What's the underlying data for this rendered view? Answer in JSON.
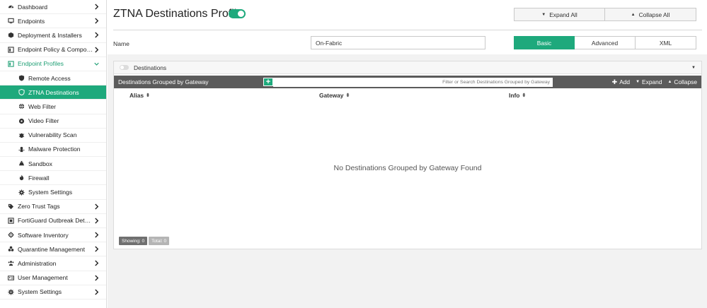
{
  "sidebar": {
    "items": [
      {
        "label": "Dashboard",
        "icon": "dashboard-icon"
      },
      {
        "label": "Endpoints",
        "icon": "monitor-icon"
      },
      {
        "label": "Deployment & Installers",
        "icon": "box-icon"
      },
      {
        "label": "Endpoint Policy & Components",
        "icon": "policy-icon"
      },
      {
        "label": "Endpoint Profiles",
        "icon": "profile-icon"
      },
      {
        "label": "Remote Access",
        "icon": "shield-icon"
      },
      {
        "label": "ZTNA Destinations",
        "icon": "shield-icon"
      },
      {
        "label": "Web Filter",
        "icon": "globe-icon"
      },
      {
        "label": "Video Filter",
        "icon": "video-icon"
      },
      {
        "label": "Vulnerability Scan",
        "icon": "bug-icon"
      },
      {
        "label": "Malware Protection",
        "icon": "malware-icon"
      },
      {
        "label": "Sandbox",
        "icon": "sandbox-icon"
      },
      {
        "label": "Firewall",
        "icon": "fire-icon"
      },
      {
        "label": "System Settings",
        "icon": "gear-icon"
      },
      {
        "label": "Zero Trust Tags",
        "icon": "tag-icon"
      },
      {
        "label": "FortiGuard Outbreak Detecti...",
        "icon": "outbreak-icon"
      },
      {
        "label": "Software Inventory",
        "icon": "inventory-icon"
      },
      {
        "label": "Quarantine Management",
        "icon": "biohazard-icon"
      },
      {
        "label": "Administration",
        "icon": "users-icon"
      },
      {
        "label": "User Management",
        "icon": "user-card-icon"
      },
      {
        "label": "System Settings",
        "icon": "gear-icon"
      }
    ]
  },
  "header": {
    "title": "ZTNA Destinations Profile",
    "expand_all": "Expand All",
    "collapse_all": "Collapse All"
  },
  "form": {
    "name_label": "Name",
    "name_value": "On-Fabric",
    "tabs": [
      "Basic",
      "Advanced",
      "XML"
    ],
    "active_tab": "Basic"
  },
  "destinations": {
    "section_title": "Destinations",
    "grid_title": "Destinations Grouped by Gateway",
    "search_placeholder": "Filter or Search Destinations Grouped by Gateway",
    "add_label": "Add",
    "expand_label": "Expand",
    "collapse_label": "Collapse",
    "columns": [
      "Alias",
      "Gateway",
      "Info"
    ],
    "empty_message": "No Destinations Grouped by Gateway Found",
    "showing": "Showing: 0",
    "total": "Total: 0"
  },
  "colors": {
    "accent": "#1ea97c",
    "toolbar": "#5b5b5b"
  }
}
